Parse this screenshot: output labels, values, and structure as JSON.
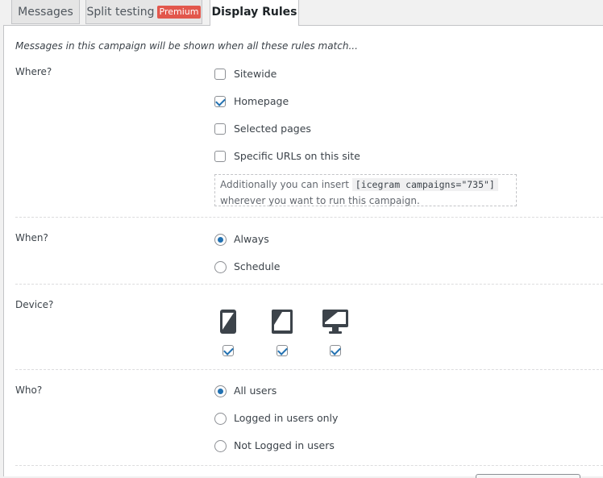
{
  "tabs": [
    {
      "label": "Messages"
    },
    {
      "label": "Split testing",
      "badge": "Premium"
    },
    {
      "label": "Display Rules"
    }
  ],
  "intro": "Messages in this campaign will be shown when all these rules match...",
  "where": {
    "label": "Where?",
    "options": [
      {
        "label": "Sitewide",
        "checked": false
      },
      {
        "label": "Homepage",
        "checked": true
      },
      {
        "label": "Selected pages",
        "checked": false
      },
      {
        "label": "Specific URLs on this site",
        "checked": false
      }
    ],
    "note_pre": "Additionally you can insert",
    "shortcode": "[icegram campaigns=\"735\"]",
    "note_post": "wherever you want to run this campaign."
  },
  "when": {
    "label": "When?",
    "options": [
      {
        "label": "Always",
        "selected": true
      },
      {
        "label": "Schedule",
        "selected": false
      }
    ]
  },
  "device": {
    "label": "Device?",
    "items": [
      {
        "icon": "mobile-icon",
        "checked": true
      },
      {
        "icon": "tablet-icon",
        "checked": true
      },
      {
        "icon": "desktop-icon",
        "checked": true
      }
    ]
  },
  "who": {
    "label": "Who?",
    "options": [
      {
        "label": "All users",
        "selected": true
      },
      {
        "label": "Logged in users only",
        "selected": false
      },
      {
        "label": "Not Logged in users",
        "selected": false
      }
    ]
  },
  "colors": {
    "accent": "#2271b1",
    "badge": "#e2574c",
    "icon": "#3c434a"
  }
}
